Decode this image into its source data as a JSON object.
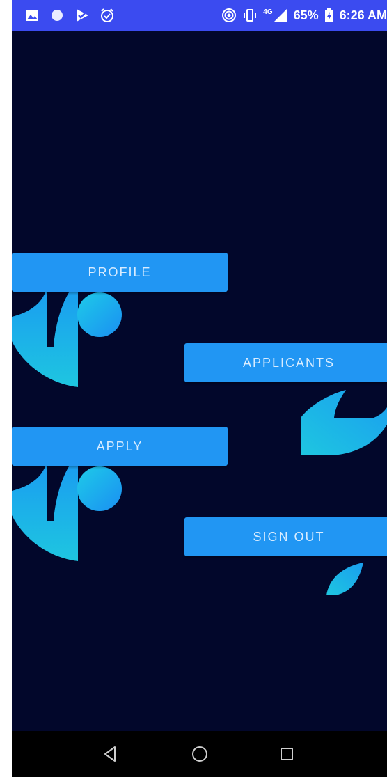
{
  "status_bar": {
    "left_icons": [
      "image-icon",
      "circle-icon",
      "play-check-icon",
      "alarm-icon"
    ],
    "right_icons": [
      "hotspot-icon",
      "vibrate-icon",
      "signal-icon",
      "battery-icon"
    ],
    "network": "4G",
    "battery": "65%",
    "time": "6:26 AM"
  },
  "buttons": {
    "profile": "PROFILE",
    "applicants": "APPLICANTS",
    "apply": "APPLY",
    "sign_out": "SIGN OUT"
  },
  "nav": {
    "icons": [
      "back-icon",
      "home-icon",
      "recents-icon"
    ]
  },
  "colors": {
    "background": "#02072b",
    "status_bar": "#3b4bf0",
    "button": "#2196f3",
    "accent_gradient_start": "#1ec6e0",
    "accent_gradient_end": "#1a9ef0",
    "nav_bar": "#000000"
  }
}
